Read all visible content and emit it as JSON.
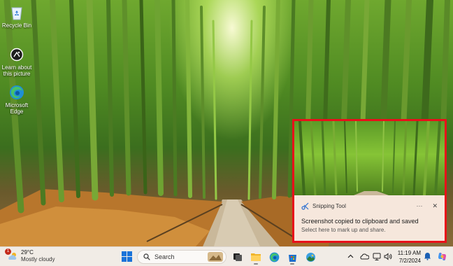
{
  "desktop": {
    "icons": [
      {
        "label": "Recycle Bin",
        "icon": "recycle-bin-icon"
      },
      {
        "label": "Learn about this picture",
        "icon": "camera-icon"
      },
      {
        "label": "Microsoft Edge",
        "icon": "edge-icon"
      }
    ]
  },
  "notification": {
    "app_name": "Snipping Tool",
    "more_glyph": "···",
    "close_glyph": "✕",
    "title": "Screenshot copied to clipboard and saved",
    "subtitle": "Select here to mark up and share.",
    "highlight_color": "#e8101a"
  },
  "taskbar": {
    "weather": {
      "badge": "1",
      "temperature": "29°C",
      "condition": "Mostly cloudy"
    },
    "search_placeholder": "Search",
    "apps": [
      "task-view-icon",
      "file-explorer-icon",
      "edge-icon",
      "store-icon",
      "photos-icon"
    ],
    "tray_icons": [
      "chevron-up-icon",
      "onedrive-icon",
      "network-icon",
      "volume-icon"
    ],
    "clock": {
      "time": "11:19 AM",
      "date": "7/2/2024"
    }
  }
}
